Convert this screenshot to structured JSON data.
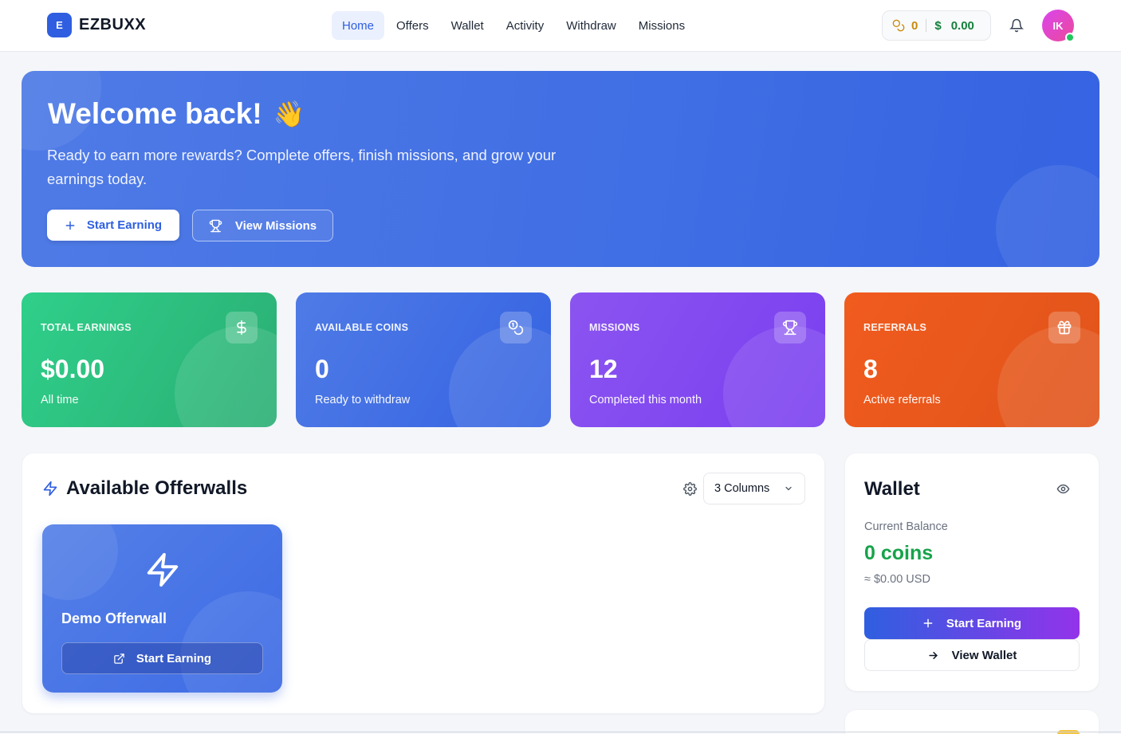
{
  "app": {
    "logo_letter": "E",
    "name": "EZBUXX"
  },
  "nav": [
    {
      "label": "Home",
      "active": true
    },
    {
      "label": "Offers"
    },
    {
      "label": "Wallet"
    },
    {
      "label": "Activity"
    },
    {
      "label": "Withdraw"
    },
    {
      "label": "Missions"
    }
  ],
  "balance": {
    "coins": "0",
    "usd": "0.00",
    "usd_symbol": "$"
  },
  "user": {
    "initials": "IK"
  },
  "hero": {
    "title": "Welcome back!",
    "emoji": "👋",
    "subtitle": "Ready to earn more rewards? Complete offers, finish missions, and grow your earnings today.",
    "primary_button": "Start Earning",
    "secondary_button": "View Missions"
  },
  "stats": [
    {
      "label": "TOTAL EARNINGS",
      "value": "$0.00",
      "desc": "All time",
      "icon": "dollar-icon"
    },
    {
      "label": "AVAILABLE COINS",
      "value": "0",
      "desc": "Ready to withdraw",
      "icon": "coins-icon"
    },
    {
      "label": "MISSIONS",
      "value": "12",
      "desc": "Completed this month",
      "icon": "trophy-icon"
    },
    {
      "label": "REFERRALS",
      "value": "8",
      "desc": "Active referrals",
      "icon": "gift-icon"
    }
  ],
  "offerwalls": {
    "title": "Available Offerwalls",
    "columns_select": "3 Columns",
    "items": [
      {
        "name": "Demo Offerwall",
        "button": "Start Earning"
      }
    ]
  },
  "wallet": {
    "title": "Wallet",
    "balance_label": "Current Balance",
    "coins": "0 coins",
    "usd": "≈ $0.00 USD",
    "primary_button": "Start Earning",
    "secondary_button": "View Wallet"
  },
  "colors": {
    "brand": "#2f5fe0",
    "earnings": "#2fcf8a",
    "coins": "#4f7be6",
    "missions": "#8b54f0",
    "referrals": "#f15b1e",
    "wallet_green": "#16a34a"
  }
}
